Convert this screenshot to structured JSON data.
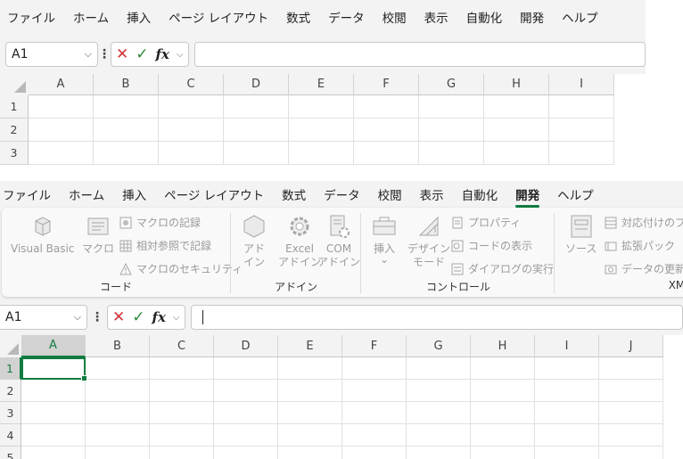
{
  "top": {
    "menu": [
      "ファイル",
      "ホーム",
      "挿入",
      "ページ レイアウト",
      "数式",
      "データ",
      "校閲",
      "表示",
      "自動化",
      "開発",
      "ヘルプ"
    ],
    "namebox": "A1",
    "formula": "",
    "columns": [
      "A",
      "B",
      "C",
      "D",
      "E",
      "F",
      "G",
      "H",
      "I"
    ],
    "rows": [
      "1",
      "2",
      "3"
    ]
  },
  "bottom": {
    "menu": [
      "ファイル",
      "ホーム",
      "挿入",
      "ページ レイアウト",
      "数式",
      "データ",
      "校閲",
      "表示",
      "自動化",
      "開発",
      "ヘルプ"
    ],
    "active_tab": "開発",
    "ribbon": {
      "code": {
        "group_label": "コード",
        "visual_basic": "Visual Basic",
        "macro": "マクロ",
        "record_macro": "マクロの記録",
        "relative_refs": "相対参照で記録",
        "macro_security": "マクロのセキュリティ"
      },
      "addins": {
        "group_label": "アドイン",
        "addin_l1": "アド",
        "addin_l2": "イン",
        "excel_l1": "Excel",
        "excel_l2": "アドイン",
        "com_l1": "COM",
        "com_l2": "アドイン"
      },
      "controls": {
        "group_label": "コントロール",
        "insert": "挿入",
        "insert_arrow": "⌄",
        "design_l1": "デザイン",
        "design_l2": "モード",
        "properties": "プロパティ",
        "view_code": "コードの表示",
        "run_dialog": "ダイアログの実行"
      },
      "xml": {
        "group_label": "XM",
        "source": "ソース",
        "map_props": "対応付けのプロ",
        "expansion_packs": "拡張パック",
        "refresh_data": "データの更新"
      }
    },
    "namebox": "A1",
    "formula": "",
    "columns": [
      "A",
      "B",
      "C",
      "D",
      "E",
      "F",
      "G",
      "H",
      "I",
      "J"
    ],
    "rows": [
      "1",
      "2",
      "3",
      "4",
      "5"
    ],
    "active_cell": "A1"
  },
  "colors": {
    "accent": "#107c41",
    "cancel": "#d13438",
    "confirm": "#2f8a3c"
  }
}
